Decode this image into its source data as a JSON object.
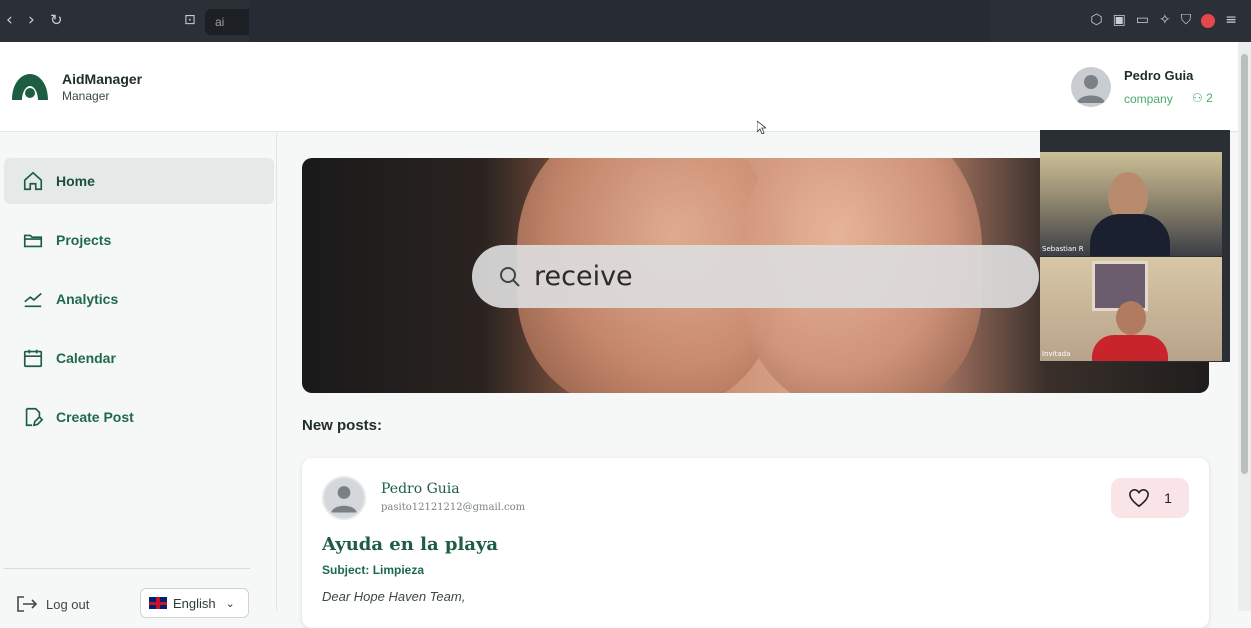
{
  "browser": {
    "url_text": "ai"
  },
  "app": {
    "brand_name": "AidManager",
    "brand_role": "Manager"
  },
  "user": {
    "name": "Pedro Guia",
    "type": "company",
    "member_count": "2"
  },
  "sidebar": {
    "items": [
      {
        "label": "Home",
        "icon": "home-icon",
        "active": true
      },
      {
        "label": "Projects",
        "icon": "folder-icon",
        "active": false
      },
      {
        "label": "Analytics",
        "icon": "chart-line-icon",
        "active": false
      },
      {
        "label": "Calendar",
        "icon": "calendar-icon",
        "active": false
      },
      {
        "label": "Create Post",
        "icon": "edit-document-icon",
        "active": false
      }
    ],
    "logout_label": "Log out",
    "language": "English"
  },
  "hero": {
    "search_text": "receive"
  },
  "video_call": {
    "participants": [
      "Sebastian R",
      "Invitada"
    ]
  },
  "feed": {
    "heading": "New posts:",
    "posts": [
      {
        "author": "Pedro Guia",
        "email": "pasito12121212@gmail.com",
        "likes": "1",
        "title": "Ayuda en la playa",
        "subject_label": "Subject:",
        "subject": "Limpieza",
        "body": "Dear Hope Haven Team,"
      }
    ]
  },
  "colors": {
    "brand_green": "#1d5e42",
    "accent_green": "#4aa96c",
    "like_bg": "#f9e4e7"
  }
}
